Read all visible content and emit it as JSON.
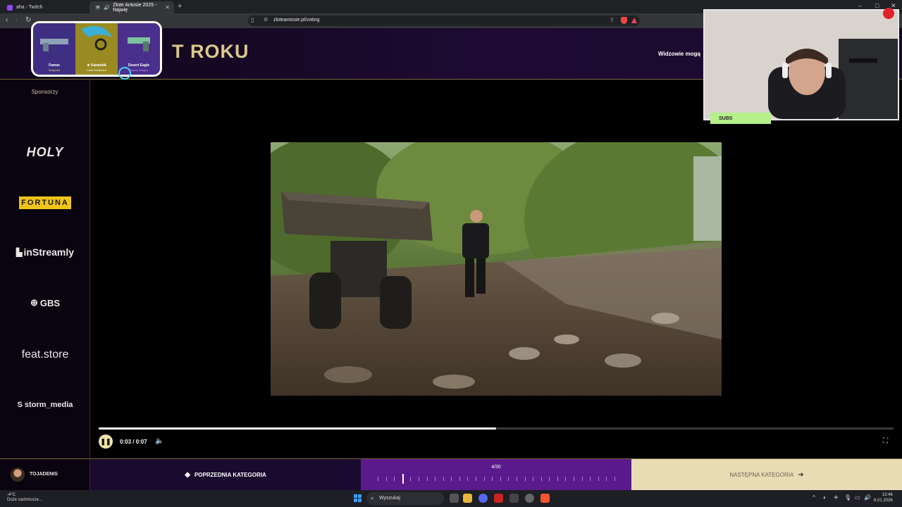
{
  "browser": {
    "tabs": [
      {
        "title": "aha - Twitch",
        "active": false
      },
      {
        "title": "Złote Antosie 2025 - Najwię",
        "active": true
      }
    ],
    "url": "zloteantosie.pl/voting"
  },
  "header": {
    "title_fragment": "T ROKU",
    "right_text": "Widzowie mogą"
  },
  "sidebar": {
    "title": "Sponsorzy",
    "sponsors": [
      "HOLY",
      "FORTUNA",
      "inStreamly",
      "GBS",
      "feat.store",
      "storm_media"
    ]
  },
  "player": {
    "time": "0:03 / 0:07",
    "progress_fraction": 0.5
  },
  "bottom_bar": {
    "username": "TOJADENIS",
    "prev_label": "POPRZEDNIA KATEGORIA",
    "progress_label": "4/30",
    "current_index": 4,
    "total": 30,
    "next_label": "NASTĘPNA KATEGORIA"
  },
  "overlay": {
    "skins": [
      {
        "name": "Famas",
        "sub": "Sergeant"
      },
      {
        "name": "★ Karambit",
        "sub": "Case Hardened"
      },
      {
        "name": "Desert Eagle",
        "sub": "Ocean Dragon"
      }
    ],
    "subs_label": "SUBS"
  },
  "taskbar": {
    "weather_temp": "-4°C",
    "weather_desc": "Duże zachmurze...",
    "search_placeholder": "Wyszukaj",
    "time": "13:46",
    "date": "6.01.2026"
  },
  "colors": {
    "header_gold": "#d9c88a",
    "progress_purple": "#5b1a8c",
    "next_beige": "#e8dcb5",
    "subs_green": "#b5f08a"
  }
}
